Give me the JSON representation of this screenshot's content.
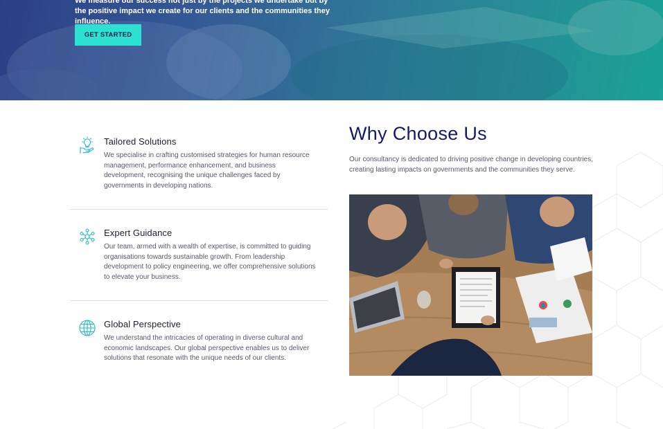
{
  "hero": {
    "text": "We measure our success not just by the projects we undertake but by the positive impact we create for our clients and the communities they influence.",
    "cta_label": "GET STARTED"
  },
  "features": [
    {
      "title": "Tailored Solutions",
      "description": "We specialise in crafting customised strategies for human resource management, performance enhancement, and business development, recognising the unique challenges faced by governments in developing nations.",
      "icon": "lightbulb-hand-icon"
    },
    {
      "title": "Expert Guidance",
      "description": "Our team, armed with a wealth of expertise, is committed to guiding organisations towards sustainable growth. From leadership development to policy engineering, we offer comprehensive solutions to elevate your business.",
      "icon": "team-network-icon"
    },
    {
      "title": "Global Perspective",
      "description": "We understand the intricacies of operating in diverse cultural and economic landscapes. Our global perspective enables us to deliver solutions that resonate with the unique needs of our clients.",
      "icon": "globe-icon"
    }
  ],
  "why": {
    "title": "Why Choose Us",
    "description": "Our consultancy is dedicated to driving positive change in developing countries, creating lasting impacts on governments and the communities they serve."
  },
  "colors": {
    "accent": "#2de1d2",
    "heading": "#16186b",
    "icon": "#1fb9c9"
  }
}
